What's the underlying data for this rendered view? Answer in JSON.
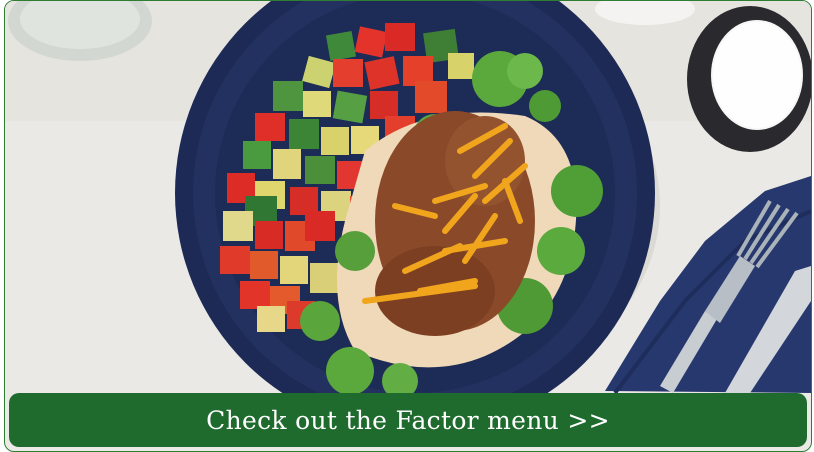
{
  "cta": {
    "label": "Check out the Factor menu >>"
  },
  "image": {
    "subject": "food-photo"
  },
  "colors": {
    "button_bg": "#1f6b2e",
    "button_text": "#ffffff",
    "plate": "#1c2a55",
    "napkin": "#27386e"
  }
}
